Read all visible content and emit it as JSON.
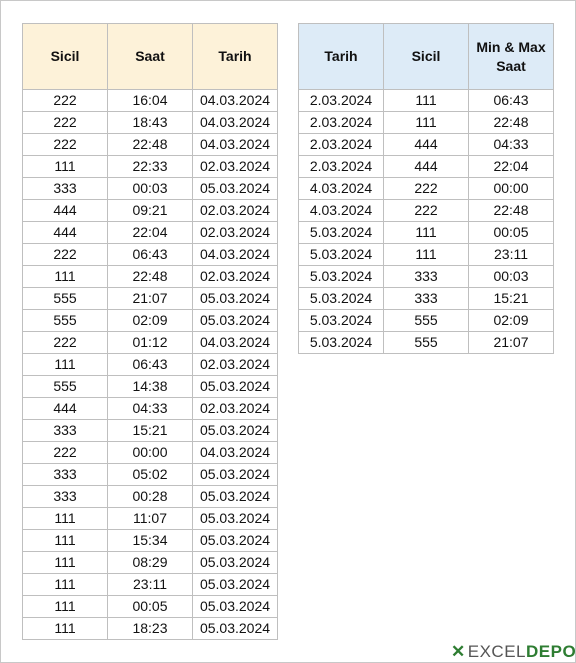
{
  "left_table": {
    "headers": [
      "Sicil",
      "Saat",
      "Tarih"
    ],
    "rows": [
      [
        "222",
        "16:04",
        "04.03.2024"
      ],
      [
        "222",
        "18:43",
        "04.03.2024"
      ],
      [
        "222",
        "22:48",
        "04.03.2024"
      ],
      [
        "111",
        "22:33",
        "02.03.2024"
      ],
      [
        "333",
        "00:03",
        "05.03.2024"
      ],
      [
        "444",
        "09:21",
        "02.03.2024"
      ],
      [
        "444",
        "22:04",
        "02.03.2024"
      ],
      [
        "222",
        "06:43",
        "04.03.2024"
      ],
      [
        "111",
        "22:48",
        "02.03.2024"
      ],
      [
        "555",
        "21:07",
        "05.03.2024"
      ],
      [
        "555",
        "02:09",
        "05.03.2024"
      ],
      [
        "222",
        "01:12",
        "04.03.2024"
      ],
      [
        "111",
        "06:43",
        "02.03.2024"
      ],
      [
        "555",
        "14:38",
        "05.03.2024"
      ],
      [
        "444",
        "04:33",
        "02.03.2024"
      ],
      [
        "333",
        "15:21",
        "05.03.2024"
      ],
      [
        "222",
        "00:00",
        "04.03.2024"
      ],
      [
        "333",
        "05:02",
        "05.03.2024"
      ],
      [
        "333",
        "00:28",
        "05.03.2024"
      ],
      [
        "111",
        "11:07",
        "05.03.2024"
      ],
      [
        "111",
        "15:34",
        "05.03.2024"
      ],
      [
        "111",
        "08:29",
        "05.03.2024"
      ],
      [
        "111",
        "23:11",
        "05.03.2024"
      ],
      [
        "111",
        "00:05",
        "05.03.2024"
      ],
      [
        "111",
        "18:23",
        "05.03.2024"
      ]
    ]
  },
  "right_table": {
    "headers": [
      "Tarih",
      "Sicil",
      "Min & Max Saat"
    ],
    "rows": [
      [
        "2.03.2024",
        "111",
        "06:43"
      ],
      [
        "2.03.2024",
        "111",
        "22:48"
      ],
      [
        "2.03.2024",
        "444",
        "04:33"
      ],
      [
        "2.03.2024",
        "444",
        "22:04"
      ],
      [
        "4.03.2024",
        "222",
        "00:00"
      ],
      [
        "4.03.2024",
        "222",
        "22:48"
      ],
      [
        "5.03.2024",
        "111",
        "00:05"
      ],
      [
        "5.03.2024",
        "111",
        "23:11"
      ],
      [
        "5.03.2024",
        "333",
        "00:03"
      ],
      [
        "5.03.2024",
        "333",
        "15:21"
      ],
      [
        "5.03.2024",
        "555",
        "02:09"
      ],
      [
        "5.03.2024",
        "555",
        "21:07"
      ]
    ]
  },
  "logo": {
    "part1": "EXCEL",
    "part2": "DEPO"
  }
}
